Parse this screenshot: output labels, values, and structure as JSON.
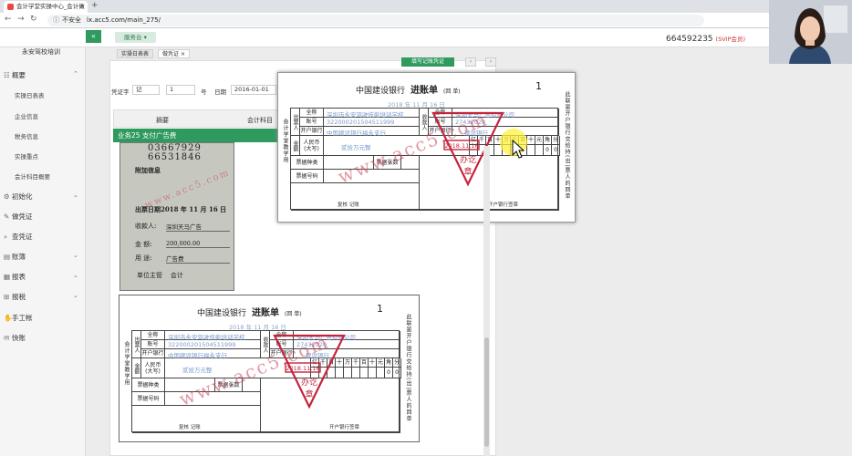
{
  "browser": {
    "tab_title": "会计学堂实操中心_会计做",
    "address_prefix": "不安全",
    "url": "lx.acc5.com/main_275/"
  },
  "header": {
    "school": "永安驾校培训",
    "service_btn": "服务台 ▾",
    "account_id": "664592235",
    "vip": "(SVIP会员)"
  },
  "sidebar": {
    "items": [
      {
        "label": "概要",
        "icon": "grid-icon"
      },
      {
        "label": "初始化",
        "icon": "settings-icon"
      },
      {
        "label": "做凭证",
        "icon": "edit-icon"
      },
      {
        "label": "查凭证",
        "icon": "search-icon"
      },
      {
        "label": "账簿",
        "icon": "book-icon"
      },
      {
        "label": "报表",
        "icon": "report-icon"
      },
      {
        "label": "报税",
        "icon": "tax-icon"
      },
      {
        "label": "手工帐",
        "icon": "hand-icon"
      },
      {
        "label": "快账",
        "icon": "note-icon"
      }
    ],
    "subitems": [
      "实操日表表",
      "企业信息",
      "税务信息",
      "实操重点",
      "会计科目概要"
    ]
  },
  "content_tabs": [
    "实操日表表",
    "做凭证"
  ],
  "toolbar": {
    "review_btn": "填写记账凭证",
    "voucher_word_label": "凭证字",
    "voucher_word_value": "记",
    "voucher_no_value": "1",
    "voucher_no_suffix": "号",
    "date_label": "日期",
    "date_value": "2016-01-01"
  },
  "table": {
    "col_summary": "摘要",
    "col_account": "会计科目",
    "business_title": "业务25 支付广告费"
  },
  "receipt": {
    "number_line1": "03667929",
    "number_line2": "66531846",
    "extra_info": "附加信息",
    "issue_date": "出票日期2018 年 11 月 16 日",
    "payee_label": "收款人:",
    "payee": "深圳天马广告",
    "amount_label": "金  额:",
    "amount": "200,000.00",
    "usage_label": "用  途:",
    "usage": "广告费",
    "unit_head": "单位主管",
    "accountant": "会计"
  },
  "slip": {
    "bank": "中国建设银行",
    "title": "进账单",
    "copy": "(回  单)",
    "number": "1",
    "date": "2018  年  11 月  16 日",
    "payer_side": "出票人",
    "payee_side": "收款人",
    "name_label": "全称",
    "account_label": "账号",
    "bank_label": "开户银行",
    "payer_name": "深圳市永安驾驶技能培训学校",
    "payer_account": "322000201504511999",
    "payer_bank": "中国建设银行福永支行",
    "payee_name": "深圳天马广告有限公司",
    "payee_account": "27432020",
    "payee_bank": "建设银行",
    "rmb_label": "人民币\n(大写)",
    "rmb_value": "贰拾万元整",
    "digit_headers": [
      "亿",
      "千",
      "百",
      "十",
      "万",
      "千",
      "百",
      "十",
      "元",
      "角",
      "分"
    ],
    "ticket_type": "票据种类",
    "ticket_count": "票据张数",
    "ticket_no": "票据号码",
    "review": "复核",
    "bookkeep": "记账",
    "bank_sign": "开户银行签章",
    "left_vertical": "会计学堂教学用",
    "right_vertical": "此联是开户银行交给持(出)票人的回单",
    "stamp_text": "办讫章",
    "stamp_date": "2018.11.16",
    "watermark": "www.acc5.com"
  }
}
